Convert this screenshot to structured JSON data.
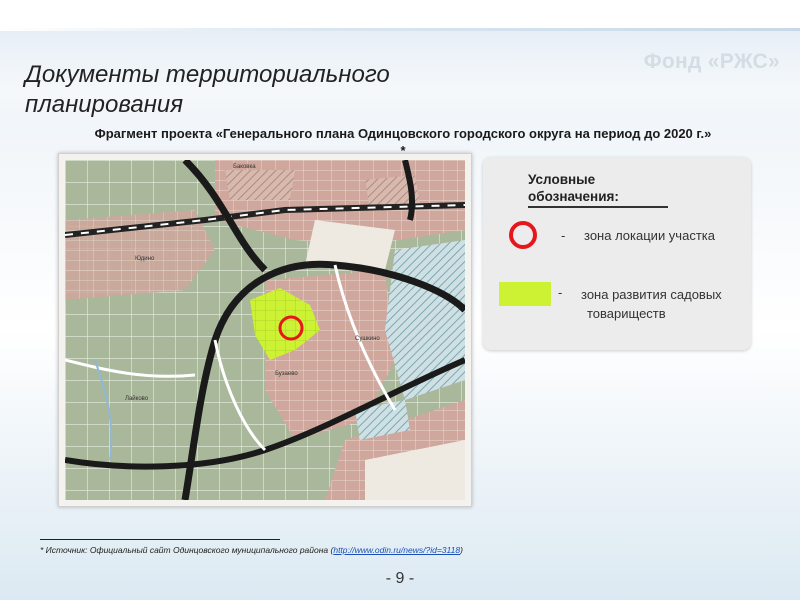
{
  "header": {
    "brand": "Фонд «РЖС»",
    "title": "Документы территориального планирования"
  },
  "subtitle": {
    "text": "Фрагмент проекта «Генерального плана Одинцовского городского округа на период до 2020 г.»",
    "mark": "*"
  },
  "map": {
    "labels": [
      "Баковка",
      "Юдино",
      "Лайково",
      "Бузаево",
      "Сушкино"
    ]
  },
  "legend": {
    "title": "Условные обозначения:",
    "items": [
      {
        "dash": "-",
        "text": "зона локации участка",
        "symbol": "red-circle",
        "color": "#e8151c"
      },
      {
        "dash": "-",
        "text_line1": "зона развития садовых",
        "text_line2": "товариществ",
        "symbol": "green-swatch",
        "color": "#ccf233"
      }
    ]
  },
  "footnote": {
    "prefix": "* Источник:  Официальный сайт Одинцовского муниципального района (",
    "link": "http://www.odin.ru/news/?id=3118",
    "suffix": ")"
  },
  "page_number": "- 9 -"
}
